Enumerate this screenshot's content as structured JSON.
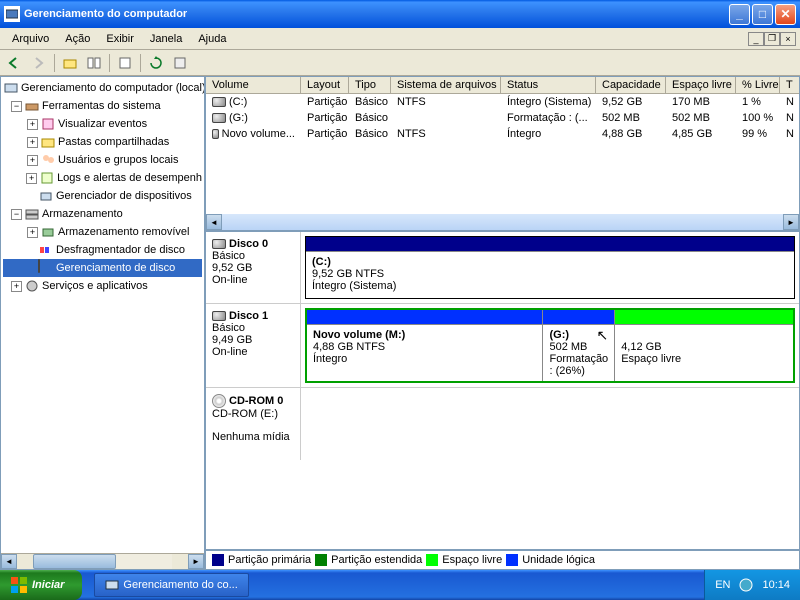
{
  "window": {
    "title": "Gerenciamento do computador"
  },
  "menu": {
    "arquivo": "Arquivo",
    "acao": "Ação",
    "exibir": "Exibir",
    "janela": "Janela",
    "ajuda": "Ajuda"
  },
  "tree": {
    "root": "Gerenciamento do computador (local)",
    "ferramentas": "Ferramentas do sistema",
    "visualizar": "Visualizar eventos",
    "pastas": "Pastas compartilhadas",
    "usuarios": "Usuários e grupos locais",
    "logs": "Logs e alertas de desempenh",
    "gerenciador_disp": "Gerenciador de dispositivos",
    "armazenamento": "Armazenamento",
    "removivel": "Armazenamento removível",
    "desfrag": "Desfragmentador de disco",
    "ger_disco": "Gerenciamento de disco",
    "servicos": "Serviços e aplicativos"
  },
  "columns": {
    "volume": "Volume",
    "layout": "Layout",
    "tipo": "Tipo",
    "sistema": "Sistema de arquivos",
    "status": "Status",
    "capacidade": "Capacidade",
    "espaco": "Espaço livre",
    "livre": "% Livre",
    "t": "T"
  },
  "volumes": [
    {
      "vol": "(C:)",
      "layout": "Partição",
      "tipo": "Básico",
      "fs": "NTFS",
      "status": "Íntegro (Sistema)",
      "cap": "9,52 GB",
      "free": "170 MB",
      "pct": "1 %",
      "n": "N"
    },
    {
      "vol": "(G:)",
      "layout": "Partição",
      "tipo": "Básico",
      "fs": "",
      "status": "Formatação : (...",
      "cap": "502 MB",
      "free": "502 MB",
      "pct": "100 %",
      "n": "N"
    },
    {
      "vol": "Novo volume...",
      "layout": "Partição",
      "tipo": "Básico",
      "fs": "NTFS",
      "status": "Íntegro",
      "cap": "4,88 GB",
      "free": "4,85 GB",
      "pct": "99 %",
      "n": "N"
    }
  ],
  "disks": {
    "d0": {
      "name": "Disco 0",
      "type": "Básico",
      "size": "9,52 GB",
      "state": "On-line",
      "p0": {
        "label": "(C:)",
        "detail": "9,52 GB NTFS",
        "status": "Íntegro (Sistema)"
      }
    },
    "d1": {
      "name": "Disco 1",
      "type": "Básico",
      "size": "9,49 GB",
      "state": "On-line",
      "p0": {
        "label": "Novo volume  (M:)",
        "detail": "4,88 GB NTFS",
        "status": "Íntegro"
      },
      "p1": {
        "label": "(G:)",
        "detail": "502 MB",
        "status": "Formatação : (26%)"
      },
      "p2": {
        "label": "",
        "detail": "4,12 GB",
        "status": "Espaço livre"
      }
    },
    "cd": {
      "name": "CD-ROM 0",
      "sub": "CD-ROM (E:)",
      "state": "Nenhuma mídia"
    }
  },
  "legend": {
    "primaria": "Partição primária",
    "estendida": "Partição estendida",
    "livre": "Espaço livre",
    "logica": "Unidade lógica"
  },
  "taskbar": {
    "start": "Iniciar",
    "task": "Gerenciamento do co...",
    "lang": "EN",
    "time": "10:14"
  },
  "colors": {
    "primary": "#00008b",
    "extended": "#008000",
    "free": "#00ff00",
    "logical": "#0030ff"
  }
}
